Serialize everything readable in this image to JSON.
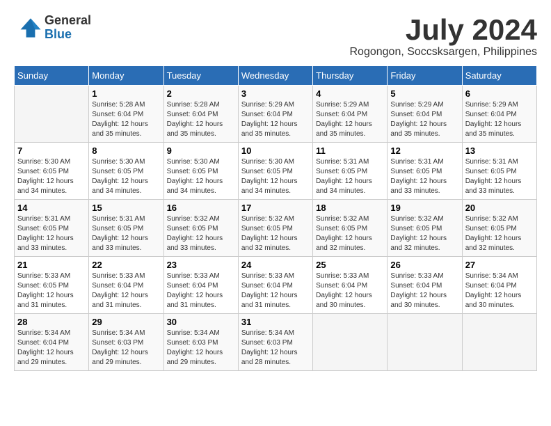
{
  "logo": {
    "general": "General",
    "blue": "Blue"
  },
  "title": {
    "month_year": "July 2024",
    "location": "Rogongon, Soccsksargen, Philippines"
  },
  "weekdays": [
    "Sunday",
    "Monday",
    "Tuesday",
    "Wednesday",
    "Thursday",
    "Friday",
    "Saturday"
  ],
  "weeks": [
    [
      {
        "day": "",
        "sunrise": "",
        "sunset": "",
        "daylight": ""
      },
      {
        "day": "1",
        "sunrise": "Sunrise: 5:28 AM",
        "sunset": "Sunset: 6:04 PM",
        "daylight": "Daylight: 12 hours and 35 minutes."
      },
      {
        "day": "2",
        "sunrise": "Sunrise: 5:28 AM",
        "sunset": "Sunset: 6:04 PM",
        "daylight": "Daylight: 12 hours and 35 minutes."
      },
      {
        "day": "3",
        "sunrise": "Sunrise: 5:29 AM",
        "sunset": "Sunset: 6:04 PM",
        "daylight": "Daylight: 12 hours and 35 minutes."
      },
      {
        "day": "4",
        "sunrise": "Sunrise: 5:29 AM",
        "sunset": "Sunset: 6:04 PM",
        "daylight": "Daylight: 12 hours and 35 minutes."
      },
      {
        "day": "5",
        "sunrise": "Sunrise: 5:29 AM",
        "sunset": "Sunset: 6:04 PM",
        "daylight": "Daylight: 12 hours and 35 minutes."
      },
      {
        "day": "6",
        "sunrise": "Sunrise: 5:29 AM",
        "sunset": "Sunset: 6:04 PM",
        "daylight": "Daylight: 12 hours and 35 minutes."
      }
    ],
    [
      {
        "day": "7",
        "sunrise": "Sunrise: 5:30 AM",
        "sunset": "Sunset: 6:05 PM",
        "daylight": "Daylight: 12 hours and 34 minutes."
      },
      {
        "day": "8",
        "sunrise": "Sunrise: 5:30 AM",
        "sunset": "Sunset: 6:05 PM",
        "daylight": "Daylight: 12 hours and 34 minutes."
      },
      {
        "day": "9",
        "sunrise": "Sunrise: 5:30 AM",
        "sunset": "Sunset: 6:05 PM",
        "daylight": "Daylight: 12 hours and 34 minutes."
      },
      {
        "day": "10",
        "sunrise": "Sunrise: 5:30 AM",
        "sunset": "Sunset: 6:05 PM",
        "daylight": "Daylight: 12 hours and 34 minutes."
      },
      {
        "day": "11",
        "sunrise": "Sunrise: 5:31 AM",
        "sunset": "Sunset: 6:05 PM",
        "daylight": "Daylight: 12 hours and 34 minutes."
      },
      {
        "day": "12",
        "sunrise": "Sunrise: 5:31 AM",
        "sunset": "Sunset: 6:05 PM",
        "daylight": "Daylight: 12 hours and 33 minutes."
      },
      {
        "day": "13",
        "sunrise": "Sunrise: 5:31 AM",
        "sunset": "Sunset: 6:05 PM",
        "daylight": "Daylight: 12 hours and 33 minutes."
      }
    ],
    [
      {
        "day": "14",
        "sunrise": "Sunrise: 5:31 AM",
        "sunset": "Sunset: 6:05 PM",
        "daylight": "Daylight: 12 hours and 33 minutes."
      },
      {
        "day": "15",
        "sunrise": "Sunrise: 5:31 AM",
        "sunset": "Sunset: 6:05 PM",
        "daylight": "Daylight: 12 hours and 33 minutes."
      },
      {
        "day": "16",
        "sunrise": "Sunrise: 5:32 AM",
        "sunset": "Sunset: 6:05 PM",
        "daylight": "Daylight: 12 hours and 33 minutes."
      },
      {
        "day": "17",
        "sunrise": "Sunrise: 5:32 AM",
        "sunset": "Sunset: 6:05 PM",
        "daylight": "Daylight: 12 hours and 32 minutes."
      },
      {
        "day": "18",
        "sunrise": "Sunrise: 5:32 AM",
        "sunset": "Sunset: 6:05 PM",
        "daylight": "Daylight: 12 hours and 32 minutes."
      },
      {
        "day": "19",
        "sunrise": "Sunrise: 5:32 AM",
        "sunset": "Sunset: 6:05 PM",
        "daylight": "Daylight: 12 hours and 32 minutes."
      },
      {
        "day": "20",
        "sunrise": "Sunrise: 5:32 AM",
        "sunset": "Sunset: 6:05 PM",
        "daylight": "Daylight: 12 hours and 32 minutes."
      }
    ],
    [
      {
        "day": "21",
        "sunrise": "Sunrise: 5:33 AM",
        "sunset": "Sunset: 6:05 PM",
        "daylight": "Daylight: 12 hours and 31 minutes."
      },
      {
        "day": "22",
        "sunrise": "Sunrise: 5:33 AM",
        "sunset": "Sunset: 6:04 PM",
        "daylight": "Daylight: 12 hours and 31 minutes."
      },
      {
        "day": "23",
        "sunrise": "Sunrise: 5:33 AM",
        "sunset": "Sunset: 6:04 PM",
        "daylight": "Daylight: 12 hours and 31 minutes."
      },
      {
        "day": "24",
        "sunrise": "Sunrise: 5:33 AM",
        "sunset": "Sunset: 6:04 PM",
        "daylight": "Daylight: 12 hours and 31 minutes."
      },
      {
        "day": "25",
        "sunrise": "Sunrise: 5:33 AM",
        "sunset": "Sunset: 6:04 PM",
        "daylight": "Daylight: 12 hours and 30 minutes."
      },
      {
        "day": "26",
        "sunrise": "Sunrise: 5:33 AM",
        "sunset": "Sunset: 6:04 PM",
        "daylight": "Daylight: 12 hours and 30 minutes."
      },
      {
        "day": "27",
        "sunrise": "Sunrise: 5:34 AM",
        "sunset": "Sunset: 6:04 PM",
        "daylight": "Daylight: 12 hours and 30 minutes."
      }
    ],
    [
      {
        "day": "28",
        "sunrise": "Sunrise: 5:34 AM",
        "sunset": "Sunset: 6:04 PM",
        "daylight": "Daylight: 12 hours and 29 minutes."
      },
      {
        "day": "29",
        "sunrise": "Sunrise: 5:34 AM",
        "sunset": "Sunset: 6:03 PM",
        "daylight": "Daylight: 12 hours and 29 minutes."
      },
      {
        "day": "30",
        "sunrise": "Sunrise: 5:34 AM",
        "sunset": "Sunset: 6:03 PM",
        "daylight": "Daylight: 12 hours and 29 minutes."
      },
      {
        "day": "31",
        "sunrise": "Sunrise: 5:34 AM",
        "sunset": "Sunset: 6:03 PM",
        "daylight": "Daylight: 12 hours and 28 minutes."
      },
      {
        "day": "",
        "sunrise": "",
        "sunset": "",
        "daylight": ""
      },
      {
        "day": "",
        "sunrise": "",
        "sunset": "",
        "daylight": ""
      },
      {
        "day": "",
        "sunrise": "",
        "sunset": "",
        "daylight": ""
      }
    ]
  ]
}
